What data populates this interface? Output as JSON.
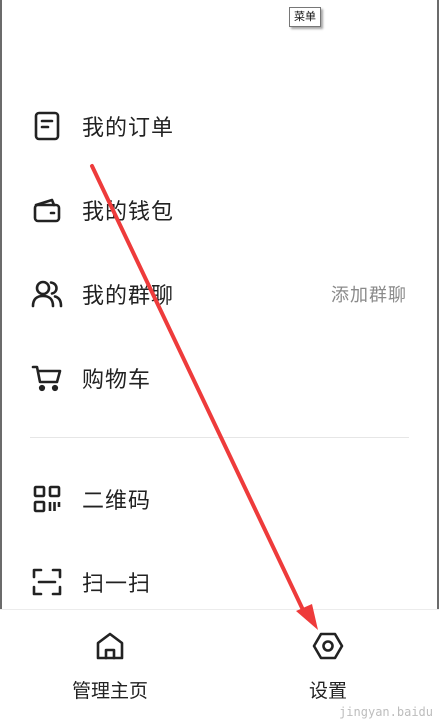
{
  "tooltip": {
    "text": "菜单"
  },
  "menu": {
    "items": [
      {
        "label": "我的订单",
        "icon": "order-icon"
      },
      {
        "label": "我的钱包",
        "icon": "wallet-icon"
      },
      {
        "label": "我的群聊",
        "icon": "group-chat-icon",
        "action": "添加群聊"
      },
      {
        "label": "购物车",
        "icon": "cart-icon"
      },
      {
        "label": "二维码",
        "icon": "qrcode-icon"
      },
      {
        "label": "扫一扫",
        "icon": "scan-icon"
      }
    ]
  },
  "bottom_bar": {
    "tabs": [
      {
        "label": "管理主页",
        "icon": "home-icon"
      },
      {
        "label": "设置",
        "icon": "settings-icon"
      }
    ]
  },
  "watermark": {
    "text": "jingyan.baidu"
  },
  "colors": {
    "text": "#222222",
    "muted": "#8a8a8a",
    "annotation_arrow": "#ee3b3b"
  }
}
